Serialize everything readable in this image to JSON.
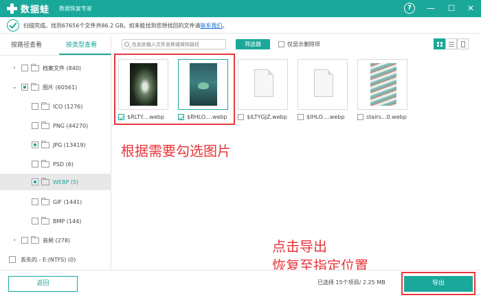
{
  "app": {
    "name": "数据蛙",
    "subtitle": "数据恢复专家"
  },
  "window_controls": {
    "help": "?",
    "minimize": "—",
    "maximize": "☐",
    "close": "✕"
  },
  "scan_status": {
    "text": "扫描完成。找到67656个文件共86.2 GB。如未能找到您想找回的文件请",
    "link": "联系我们",
    "suffix": "。"
  },
  "view_tabs": {
    "by_path": "按路径查看",
    "by_type": "按类型查看"
  },
  "tree": [
    {
      "label": "档案文件 (840)",
      "arrow": "›",
      "check": "none"
    },
    {
      "label": "图片 (60561)",
      "arrow": "⌄",
      "check": "partial"
    },
    {
      "label": "ICO (1276)",
      "arrow": "",
      "check": "none"
    },
    {
      "label": "PNG (44270)",
      "arrow": "",
      "check": "none"
    },
    {
      "label": "JPG (13419)",
      "arrow": "",
      "check": "partial"
    },
    {
      "label": "PSD (6)",
      "arrow": "",
      "check": "none"
    },
    {
      "label": "WEBP (5)",
      "arrow": "",
      "check": "partial"
    },
    {
      "label": "GIF (1441)",
      "arrow": "",
      "check": "none"
    },
    {
      "label": "BMP (144)",
      "arrow": "",
      "check": "none"
    },
    {
      "label": "音频 (278)",
      "arrow": "›",
      "check": "none"
    },
    {
      "label": "丢失的 - E:(NTFS) (0)",
      "arrow": "",
      "check": "none"
    }
  ],
  "toolbar": {
    "search_placeholder": "在此处输入文件名称或保存路径",
    "filter_label": "筛选器",
    "deleted_only_label": "仅显示删除项"
  },
  "files": [
    {
      "name": "$RLTY....webp",
      "checked": true,
      "thumb": "flower"
    },
    {
      "name": "$RHLO....webp",
      "checked": true,
      "thumb": "bird"
    },
    {
      "name": "$ILTYGJZ.webp",
      "checked": false,
      "thumb": "doc"
    },
    {
      "name": "$IHLO....webp",
      "checked": false,
      "thumb": "doc"
    },
    {
      "name": "stairs...0.webp",
      "checked": false,
      "thumb": "stairs"
    }
  ],
  "annotations": {
    "select_hint": "根据需要勾选图片",
    "export_hint_line1": "点击导出",
    "export_hint_line2": "恢复至指定位置"
  },
  "bottom": {
    "back_label": "返回",
    "selected_info": "已选择 15个项目/ 2.25 MB",
    "export_label": "导出"
  },
  "colors": {
    "accent": "#1aa89a",
    "annotation_red": "#e8363a",
    "link": "#1a6fd6"
  }
}
